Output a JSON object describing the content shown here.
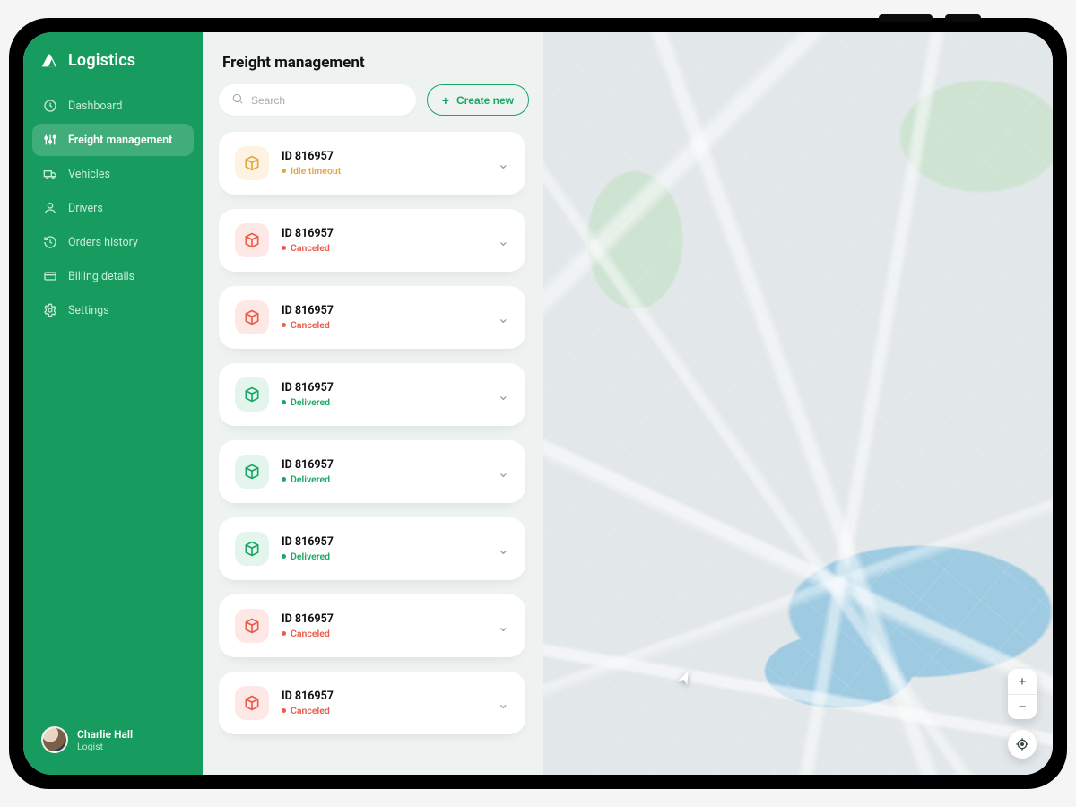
{
  "brand": {
    "name": "Logistics"
  },
  "sidebar": {
    "items": [
      {
        "label": "Dashboard",
        "icon": "clock-icon"
      },
      {
        "label": "Freight management",
        "icon": "sliders-icon",
        "active": true
      },
      {
        "label": "Vehicles",
        "icon": "truck-icon"
      },
      {
        "label": "Drivers",
        "icon": "user-icon"
      },
      {
        "label": "Orders history",
        "icon": "history-icon"
      },
      {
        "label": "Billing details",
        "icon": "card-icon"
      },
      {
        "label": "Settings",
        "icon": "gear-icon"
      }
    ],
    "user": {
      "name": "Charlie Hall",
      "role": "Logist"
    }
  },
  "panel": {
    "title": "Freight management",
    "search_placeholder": "Search",
    "create_label": "Create new"
  },
  "statuses": {
    "idle": {
      "label": "Idle timeout",
      "class": "idle"
    },
    "canceled": {
      "label": "Canceled",
      "class": "canceled"
    },
    "delivered": {
      "label": "Delivered",
      "class": "delivered"
    }
  },
  "freights": [
    {
      "id": "ID 816957",
      "status": "idle"
    },
    {
      "id": "ID 816957",
      "status": "canceled"
    },
    {
      "id": "ID 816957",
      "status": "canceled"
    },
    {
      "id": "ID 816957",
      "status": "delivered"
    },
    {
      "id": "ID 816957",
      "status": "delivered"
    },
    {
      "id": "ID 816957",
      "status": "delivered"
    },
    {
      "id": "ID 816957",
      "status": "canceled"
    },
    {
      "id": "ID 816957",
      "status": "canceled"
    }
  ],
  "map_controls": {
    "zoom_in": "+",
    "zoom_out": "−"
  },
  "colors": {
    "primary": "#179b5e",
    "accent": "#1aa765",
    "idle": "#e6a63a",
    "canceled": "#e85c4a",
    "delivered": "#1aa765"
  }
}
